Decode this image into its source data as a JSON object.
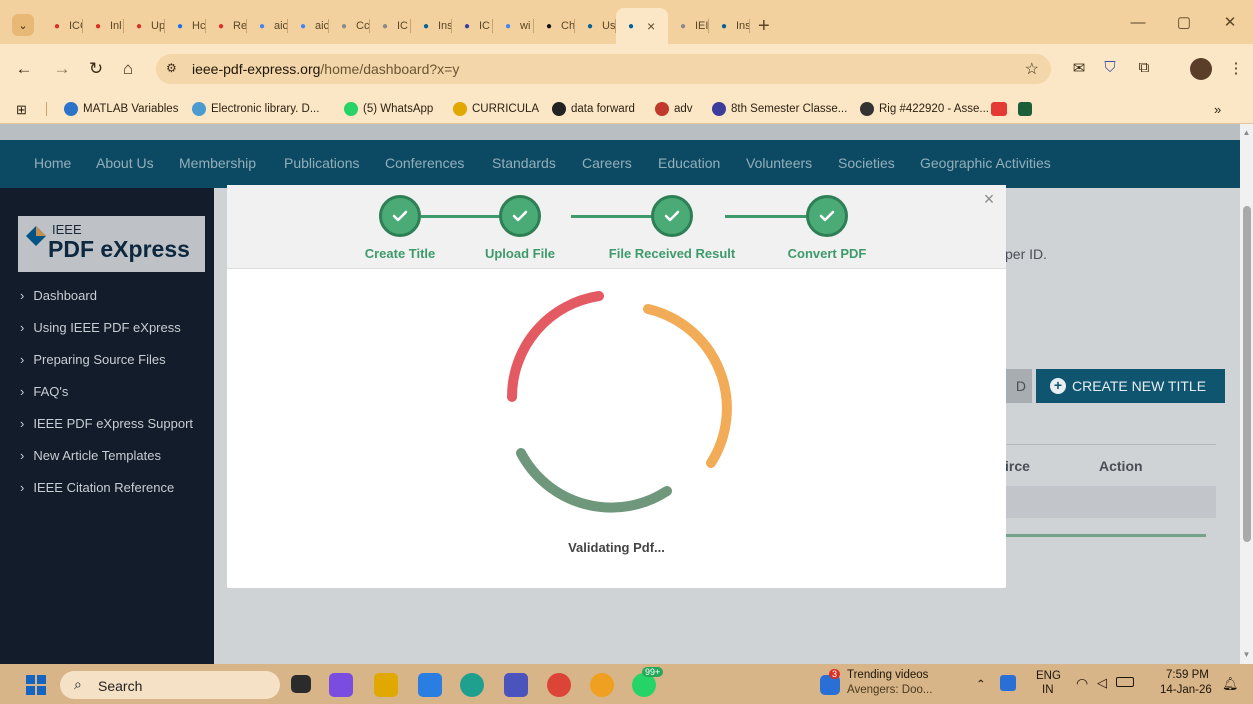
{
  "browser": {
    "tabs": [
      {
        "label": "ICC",
        "icon": "gmail-icon",
        "color": "#d93025"
      },
      {
        "label": "Inl",
        "icon": "gmail-icon",
        "color": "#d93025"
      },
      {
        "label": "Up",
        "icon": "gmail-icon",
        "color": "#d93025"
      },
      {
        "label": "Hc",
        "icon": "drive-icon",
        "color": "#1a73e8"
      },
      {
        "label": "Re",
        "icon": "gmail-icon",
        "color": "#d93025"
      },
      {
        "label": "aic",
        "icon": "google-icon",
        "color": "#4285f4"
      },
      {
        "label": "aic",
        "icon": "google-icon",
        "color": "#4285f4"
      },
      {
        "label": "Cc",
        "icon": "globe-icon",
        "color": "#8a8a8a"
      },
      {
        "label": "IC",
        "icon": "globe-icon",
        "color": "#8a8a8a"
      },
      {
        "label": "Ins",
        "icon": "ieee-icon",
        "color": "#00629b"
      },
      {
        "label": "IC",
        "icon": "list-icon",
        "color": "#3c3c9c"
      },
      {
        "label": "wi",
        "icon": "google-icon",
        "color": "#4285f4"
      },
      {
        "label": "Ch",
        "icon": "d-icon",
        "color": "#111111"
      },
      {
        "label": "Us",
        "icon": "ieee-icon",
        "color": "#00629b"
      },
      {
        "label": "",
        "icon": "ieee-icon",
        "color": "#00629b",
        "active": true
      },
      {
        "label": "IEI",
        "icon": "globe-icon",
        "color": "#8a8a8a"
      },
      {
        "label": "Ins",
        "icon": "ieee-icon",
        "color": "#00629b"
      }
    ],
    "active_tab_close": "×",
    "new_tab": "+",
    "window_controls": {
      "minimize": "—",
      "restore": "▢",
      "close": "✕"
    },
    "url_host": "ieee-pdf-express.org",
    "url_path": "/home/dashboard?x=y",
    "bookmarks": [
      {
        "label": "MATLAB Variables",
        "color": "#2a73c9"
      },
      {
        "label": "Electronic library. D...",
        "color": "#4b9bd1"
      },
      {
        "label": "(5) WhatsApp",
        "color": "#25d366"
      },
      {
        "label": "CURRICULA",
        "color": "#e0a800"
      },
      {
        "label": "data forward",
        "color": "#222222"
      },
      {
        "label": "adv",
        "color": "#c0392b"
      },
      {
        "label": "8th Semester Classe...",
        "color": "#3c3c9c"
      },
      {
        "label": "Rig #422920 - Asse...",
        "color": "#333333"
      }
    ],
    "bookmarks_more": "»"
  },
  "site": {
    "nav": [
      "Home",
      "About Us",
      "Membership",
      "Publications",
      "Conferences",
      "Standards",
      "Careers",
      "Education",
      "Volunteers",
      "Societies",
      "Geographic Activities"
    ],
    "logo_top": "IEEE",
    "logo_main": "PDF eXpress",
    "sidebar": [
      "Dashboard",
      "Using IEEE PDF eXpress",
      "Preparing Source Files",
      "FAQ's",
      "IEEE PDF eXpress Support",
      "New Article Templates",
      "IEEE Citation Reference"
    ],
    "paper_id_fragment": "per ID.",
    "btn_d": "D",
    "btn_create": "CREATE NEW TITLE",
    "col_source_fragment": "irce",
    "col_action": "Action"
  },
  "modal": {
    "steps": [
      "Create Title",
      "Upload File",
      "File Received Result",
      "Convert PDF"
    ],
    "status": "Validating Pdf...",
    "close": "×",
    "colors": {
      "step": "#4aab76",
      "red": "#e35a63",
      "orange": "#f2ac57",
      "green": "#6e977c"
    }
  },
  "taskbar": {
    "search_label": "Search",
    "badge_count": "99+",
    "notif_count": "3",
    "trending_title": "Trending videos",
    "trending_sub": "Avengers: Doo...",
    "lang_top": "ENG",
    "lang_bottom": "IN",
    "time": "7:59 PM",
    "date": "14-Jan-26"
  }
}
